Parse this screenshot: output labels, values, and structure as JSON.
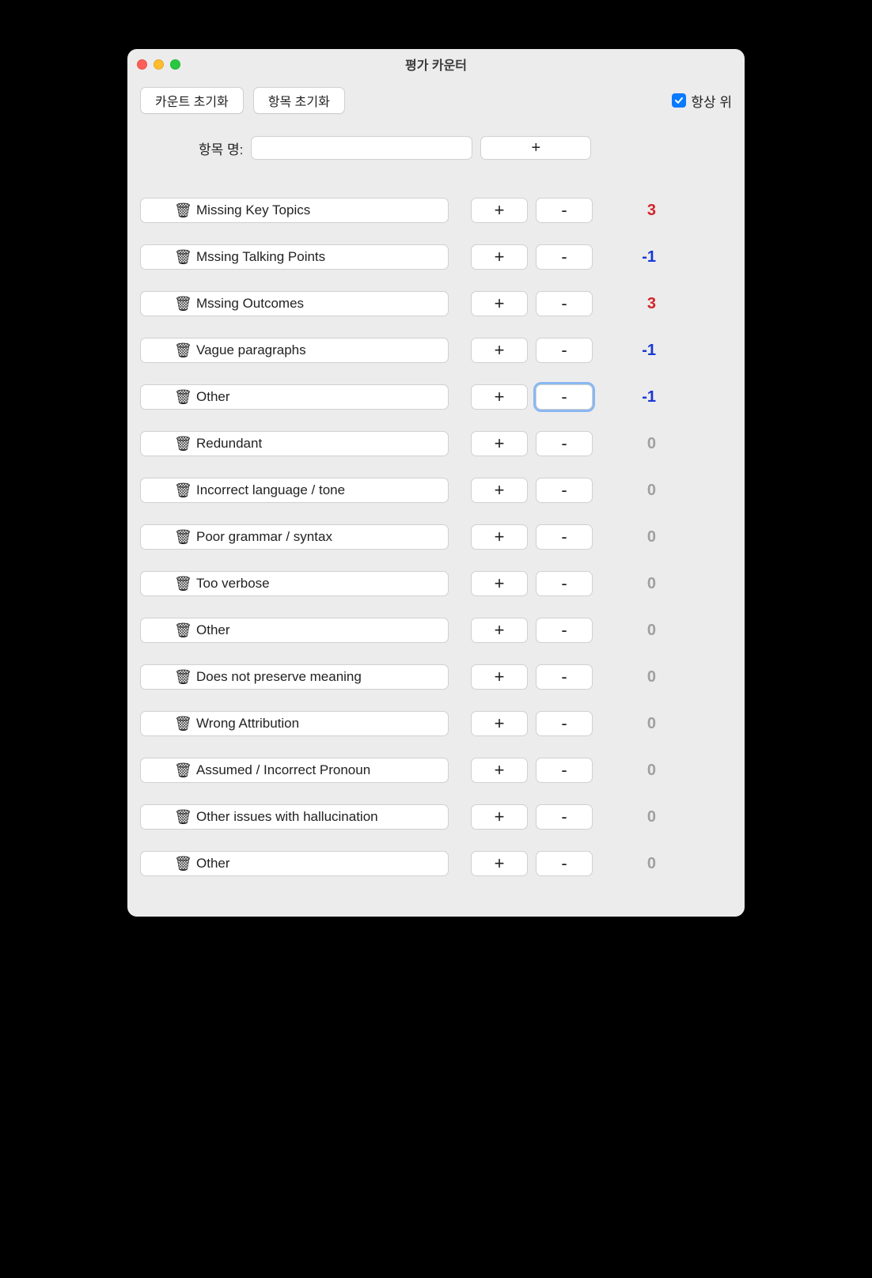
{
  "window": {
    "title": "평가 카운터"
  },
  "toolbar": {
    "reset_count_label": "카운트 초기화",
    "reset_items_label": "항목 초기화",
    "always_top_label": "항상 위",
    "always_top_checked": true
  },
  "add": {
    "label": "항목 명:",
    "value": "",
    "placeholder": "",
    "plus_label": "+"
  },
  "plus_label": "+",
  "minus_label": "-",
  "trash_icon": "🗑",
  "items": [
    {
      "label": "Missing Key Topics",
      "count": 3,
      "focused": null
    },
    {
      "label": "Mssing Talking Points",
      "count": -1,
      "focused": null
    },
    {
      "label": "Mssing Outcomes",
      "count": 3,
      "focused": null
    },
    {
      "label": "Vague paragraphs",
      "count": -1,
      "focused": null
    },
    {
      "label": "Other",
      "count": -1,
      "focused": "minus"
    },
    {
      "label": "Redundant",
      "count": 0,
      "focused": null
    },
    {
      "label": "Incorrect language / tone",
      "count": 0,
      "focused": null
    },
    {
      "label": "Poor grammar / syntax",
      "count": 0,
      "focused": null
    },
    {
      "label": "Too verbose",
      "count": 0,
      "focused": null
    },
    {
      "label": "Other",
      "count": 0,
      "focused": null
    },
    {
      "label": "Does not preserve meaning",
      "count": 0,
      "focused": null
    },
    {
      "label": "Wrong Attribution",
      "count": 0,
      "focused": null
    },
    {
      "label": "Assumed / Incorrect Pronoun",
      "count": 0,
      "focused": null
    },
    {
      "label": "Other issues with hallucination",
      "count": 0,
      "focused": null
    },
    {
      "label": "Other",
      "count": 0,
      "focused": null
    }
  ]
}
